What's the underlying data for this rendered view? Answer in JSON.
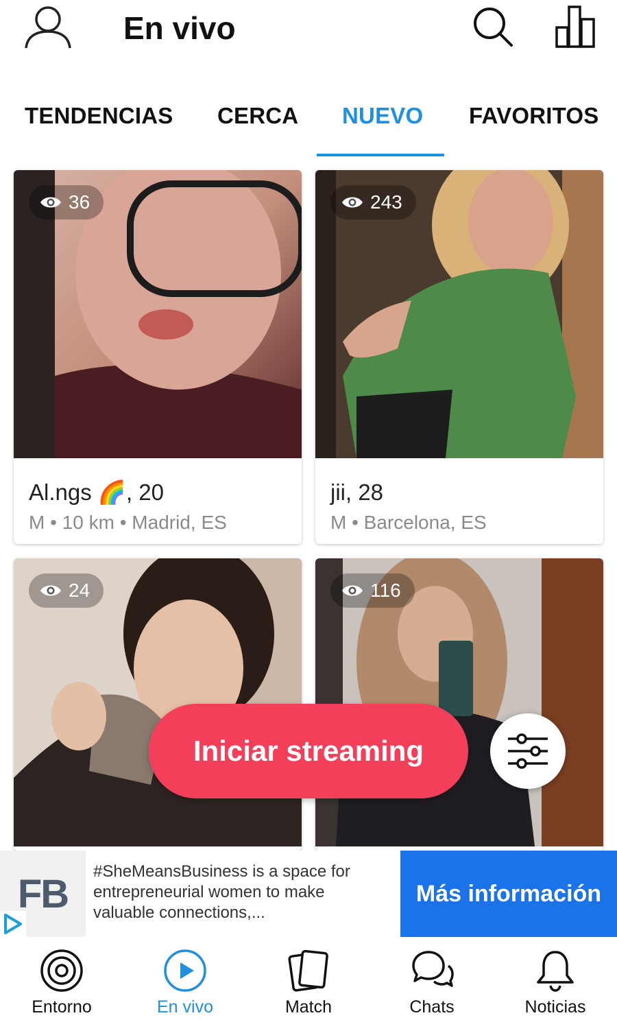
{
  "header": {
    "title": "En vivo"
  },
  "tabs": [
    {
      "label": "TENDENCIAS",
      "active": false
    },
    {
      "label": "CERCA",
      "active": false
    },
    {
      "label": "NUEVO",
      "active": true
    },
    {
      "label": "FAVORITOS",
      "active": false
    }
  ],
  "cards": [
    {
      "viewers": "36",
      "name": "Al.ngs 🌈, 20",
      "meta": "M • 10 km • Madrid, ES"
    },
    {
      "viewers": "243",
      "name": "jii, 28",
      "meta": "M • Barcelona, ES"
    },
    {
      "viewers": "24",
      "name": "",
      "meta": ""
    },
    {
      "viewers": "116",
      "name": "",
      "meta": ""
    }
  ],
  "cta": {
    "label": "Iniciar streaming"
  },
  "ad": {
    "logo": "FB",
    "text": "#SheMeansBusiness is a space for entrepreneurial women to make valuable connections,...",
    "cta": "Más información"
  },
  "bottom_nav": [
    {
      "label": "Entorno",
      "icon": "radar-icon",
      "active": false
    },
    {
      "label": "En vivo",
      "icon": "play-icon",
      "active": true
    },
    {
      "label": "Match",
      "icon": "cards-icon",
      "active": false
    },
    {
      "label": "Chats",
      "icon": "chat-bubbles-icon",
      "active": false
    },
    {
      "label": "Noticias",
      "icon": "bell-icon",
      "active": false
    }
  ],
  "colors": {
    "accent": "#1f8fe0",
    "cta": "#f43f5a",
    "ad_button": "#1a73e8"
  }
}
